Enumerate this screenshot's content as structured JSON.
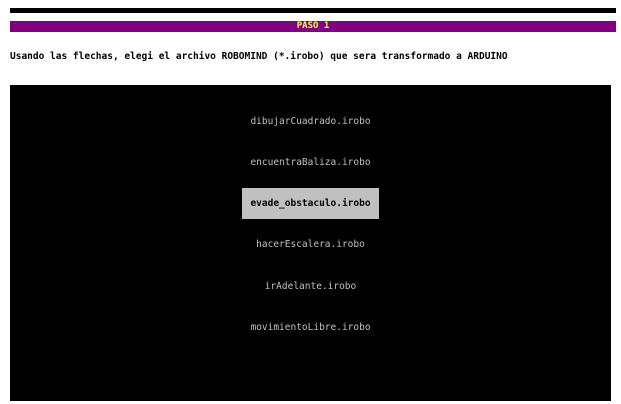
{
  "header": {
    "step_label": "PASO 1"
  },
  "instruction": "Usando las flechas, elegi el archivo ROBOMIND (*.irobo) que sera transformado a ARDUINO",
  "files": [
    {
      "name": "dibujarCuadrado.irobo",
      "selected": false
    },
    {
      "name": "encuentraBaliza.irobo",
      "selected": false
    },
    {
      "name": "evade_obstaculo.irobo",
      "selected": true
    },
    {
      "name": "hacerEscalera.irobo",
      "selected": false
    },
    {
      "name": "irAdelante.irobo",
      "selected": false
    },
    {
      "name": "movimientoLibre.irobo",
      "selected": false
    }
  ],
  "colors": {
    "banner_bg": "#800080",
    "banner_text": "#ffff55",
    "panel_bg": "#000000",
    "item_text": "#c0c0c0",
    "selection_bg": "#c0c0c0"
  }
}
